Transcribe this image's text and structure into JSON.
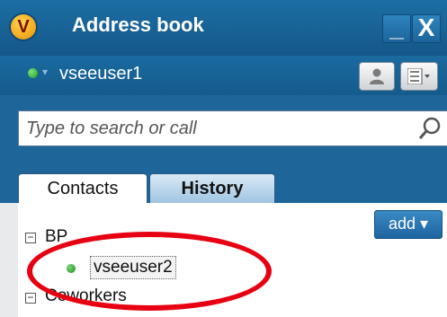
{
  "window": {
    "title": "Address book",
    "minimize_label": "_",
    "close_label": "X"
  },
  "app_logo": "V",
  "user": {
    "name": "vseeuser1",
    "status_color": "#2a9d2a"
  },
  "search": {
    "placeholder": "Type to search or call"
  },
  "tabs": [
    {
      "label": "Contacts",
      "active": true
    },
    {
      "label": "History",
      "active": false
    }
  ],
  "toolbar": {
    "add_label": "add ▾"
  },
  "groups": [
    {
      "name": "BP",
      "expander": "−",
      "contacts": [
        {
          "name": "vseeuser2",
          "status": "online"
        }
      ]
    },
    {
      "name": "Coworkers",
      "expander": "−"
    }
  ],
  "colors": {
    "accent": "#1e659a",
    "annotation": "#e60012"
  }
}
